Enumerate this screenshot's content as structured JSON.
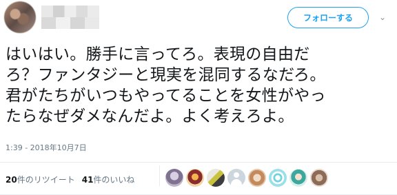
{
  "follow_button": {
    "label": "フォローする"
  },
  "tweet": {
    "lines": [
      "はいはい。勝手に言ってろ。表現の自由だ",
      "ろ？ファンタジーと現実を混同するなだろ。",
      "君がたちがいつもやってることを女性がやっ",
      "たらなぜダメなんだよ。よく考えろよ。"
    ],
    "timestamp": "1:39 - 2018年10月7日"
  },
  "stats": {
    "retweets_count": "20",
    "retweets_label": "件のリツイート",
    "likes_count": "41",
    "likes_label": "件のいいね"
  },
  "colors": {
    "accent": "#1da1f2",
    "muted": "#657786",
    "divider": "#e6ecf0"
  }
}
